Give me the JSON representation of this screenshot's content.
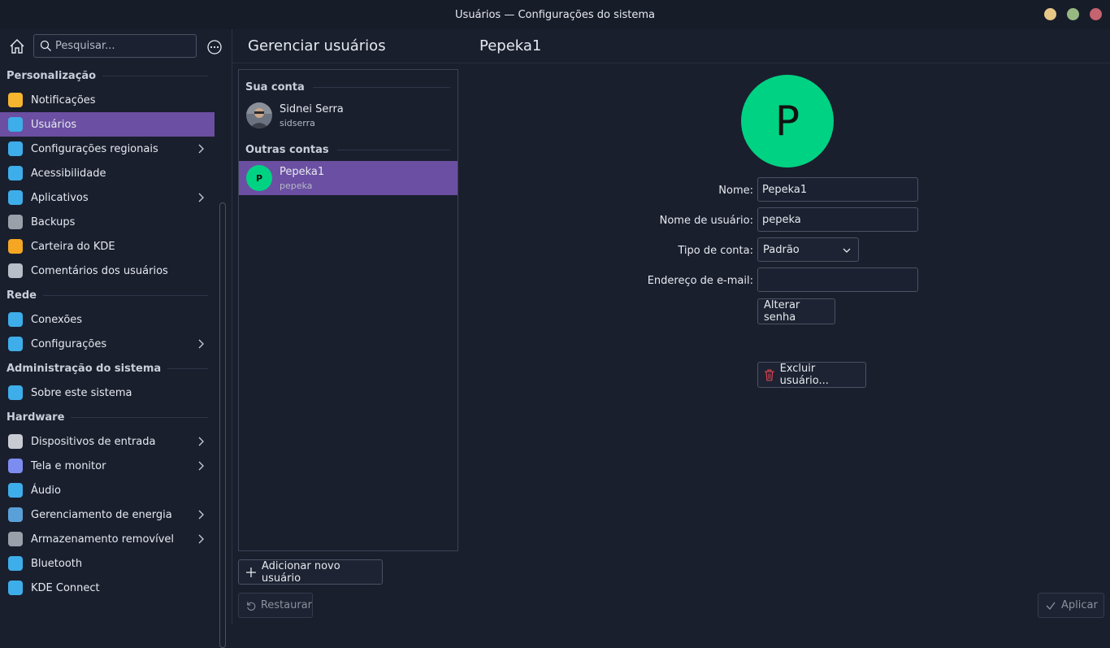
{
  "window": {
    "title": "Usuários — Configurações do sistema"
  },
  "sidebar": {
    "search_placeholder": "Pesquisar...",
    "sections": [
      {
        "label": "Personalização",
        "items": [
          {
            "label": "Notificações",
            "icon": "notifications-icon",
            "color": "#f5b52e",
            "chevron": false,
            "active": false
          },
          {
            "label": "Usuários",
            "icon": "users-icon",
            "color": "#3daee9",
            "chevron": false,
            "active": true
          },
          {
            "label": "Configurações regionais",
            "icon": "regional-settings-icon",
            "color": "#3daee9",
            "chevron": true,
            "active": false
          },
          {
            "label": "Acessibilidade",
            "icon": "accessibility-icon",
            "color": "#3daee9",
            "chevron": false,
            "active": false
          },
          {
            "label": "Aplicativos",
            "icon": "applications-icon",
            "color": "#3daee9",
            "chevron": true,
            "active": false
          },
          {
            "label": "Backups",
            "icon": "backups-icon",
            "color": "#9aa0aa",
            "chevron": false,
            "active": false
          },
          {
            "label": "Carteira do KDE",
            "icon": "kde-wallet-icon",
            "color": "#f5a623",
            "chevron": false,
            "active": false
          },
          {
            "label": "Comentários dos usuários",
            "icon": "user-feedback-icon",
            "color": "#b8bec8",
            "chevron": false,
            "active": false
          }
        ]
      },
      {
        "label": "Rede",
        "items": [
          {
            "label": "Conexões",
            "icon": "connections-icon",
            "color": "#3daee9",
            "chevron": false,
            "active": false
          },
          {
            "label": "Configurações",
            "icon": "network-settings-icon",
            "color": "#3daee9",
            "chevron": true,
            "active": false
          }
        ]
      },
      {
        "label": "Administração do sistema",
        "items": [
          {
            "label": "Sobre este sistema",
            "icon": "info-icon",
            "color": "#3daee9",
            "chevron": false,
            "active": false
          }
        ]
      },
      {
        "label": "Hardware",
        "items": [
          {
            "label": "Dispositivos de entrada",
            "icon": "input-devices-icon",
            "color": "#c8ccd2",
            "chevron": true,
            "active": false
          },
          {
            "label": "Tela e monitor",
            "icon": "display-icon",
            "color": "#7d8cf0",
            "chevron": true,
            "active": false
          },
          {
            "label": "Áudio",
            "icon": "audio-icon",
            "color": "#3daee9",
            "chevron": false,
            "active": false
          },
          {
            "label": "Gerenciamento de energia",
            "icon": "power-management-icon",
            "color": "#5aa0d8",
            "chevron": true,
            "active": false
          },
          {
            "label": "Armazenamento removível",
            "icon": "removable-storage-icon",
            "color": "#9aa0aa",
            "chevron": true,
            "active": false
          },
          {
            "label": "Bluetooth",
            "icon": "bluetooth-icon",
            "color": "#3daee9",
            "chevron": false,
            "active": false
          },
          {
            "label": "KDE Connect",
            "icon": "kde-connect-icon",
            "color": "#3daee9",
            "chevron": false,
            "active": false
          }
        ]
      }
    ]
  },
  "users_panel": {
    "title": "Gerenciar usuários",
    "your_account_label": "Sua conta",
    "other_accounts_label": "Outras contas",
    "your_account": {
      "name": "Sidnei Serra",
      "login": "sidserra"
    },
    "other_accounts": [
      {
        "name": "Pepeka1",
        "login": "pepeka",
        "avatar_letter": "P",
        "avatar_color": "#00d283"
      }
    ],
    "add_button": "Adicionar novo usuário",
    "restore_button": "Restaurar"
  },
  "detail": {
    "title": "Pepeka1",
    "avatar_letter": "P",
    "avatar_color": "#00d283",
    "name_label": "Nome:",
    "name_value": "Pepeka1",
    "username_label": "Nome de usuário:",
    "username_value": "pepeka",
    "account_type_label": "Tipo de conta:",
    "account_type_value": "Padrão",
    "email_label": "Endereço de e-mail:",
    "email_value": "",
    "change_password_button": "Alterar senha",
    "delete_button": "Excluir usuário...",
    "apply_button": "Aplicar"
  },
  "colors": {
    "accent": "#6b4fa2",
    "background": "#1a1f2e"
  }
}
